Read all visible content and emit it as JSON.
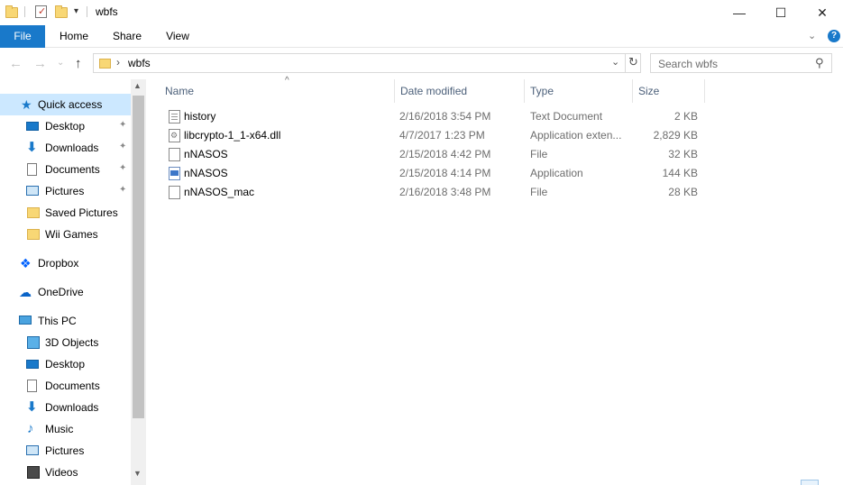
{
  "window": {
    "title": "wbfs",
    "minimize_glyph": "—",
    "maximize_glyph": "☐",
    "close_glyph": "✕"
  },
  "quick_access_toolbar": {
    "dropdown_glyph": "▾"
  },
  "ribbon": {
    "tabs": [
      "File",
      "Home",
      "Share",
      "View"
    ],
    "collapse_glyph": "⌄",
    "help_glyph": "?"
  },
  "navigation": {
    "back_glyph": "←",
    "forward_glyph": "→",
    "recent_glyph": "⌄",
    "up_glyph": "↑"
  },
  "address_bar": {
    "separator": "›",
    "path": "wbfs",
    "dropdown_glyph": "⌄",
    "refresh_glyph": "↻"
  },
  "search": {
    "placeholder": "Search wbfs",
    "icon_glyph": "⚲"
  },
  "nav_pane": {
    "items": [
      {
        "label": "Quick access",
        "icon": "star-icon"
      },
      {
        "label": "Desktop",
        "icon": "desktop-icon",
        "pinned": true
      },
      {
        "label": "Downloads",
        "icon": "download-icon",
        "pinned": true
      },
      {
        "label": "Documents",
        "icon": "documents-icon",
        "pinned": true
      },
      {
        "label": "Pictures",
        "icon": "pictures-icon",
        "pinned": true
      },
      {
        "label": "Saved Pictures",
        "icon": "folder-icon"
      },
      {
        "label": "Wii Games",
        "icon": "folder-icon"
      },
      {
        "label": "Dropbox",
        "icon": "dropbox-icon"
      },
      {
        "label": "OneDrive",
        "icon": "cloud-icon"
      },
      {
        "label": "This PC",
        "icon": "computer-icon"
      },
      {
        "label": "3D Objects",
        "icon": "cube-icon"
      },
      {
        "label": "Desktop",
        "icon": "desktop-icon"
      },
      {
        "label": "Documents",
        "icon": "documents-icon"
      },
      {
        "label": "Downloads",
        "icon": "download-icon"
      },
      {
        "label": "Music",
        "icon": "music-icon"
      },
      {
        "label": "Pictures",
        "icon": "pictures-icon"
      },
      {
        "label": "Videos",
        "icon": "video-icon"
      }
    ],
    "pin_glyph": "📌",
    "scroll_up_glyph": "▲",
    "scroll_down_glyph": "▼"
  },
  "file_list": {
    "columns": [
      "Name",
      "Date modified",
      "Type",
      "Size"
    ],
    "sort_glyph": "^",
    "rows": [
      {
        "name": "history",
        "date": "2/16/2018 3:54 PM",
        "type": "Text Document",
        "size": "2 KB",
        "icon": "text-file-icon"
      },
      {
        "name": "libcrypto-1_1-x64.dll",
        "date": "4/7/2017 1:23 PM",
        "type": "Application exten...",
        "size": "2,829 KB",
        "icon": "dll-file-icon"
      },
      {
        "name": "nNASOS",
        "date": "2/15/2018 4:42 PM",
        "type": "File",
        "size": "32 KB",
        "icon": "file-icon"
      },
      {
        "name": "nNASOS",
        "date": "2/15/2018 4:14 PM",
        "type": "Application",
        "size": "144 KB",
        "icon": "application-icon"
      },
      {
        "name": "nNASOS_mac",
        "date": "2/16/2018 3:48 PM",
        "type": "File",
        "size": "28 KB",
        "icon": "file-icon"
      }
    ]
  },
  "colors": {
    "accent": "#1979ca",
    "selection": "#cce8ff",
    "header_text": "#4c607a",
    "secondary_text": "#6d6d6d"
  }
}
